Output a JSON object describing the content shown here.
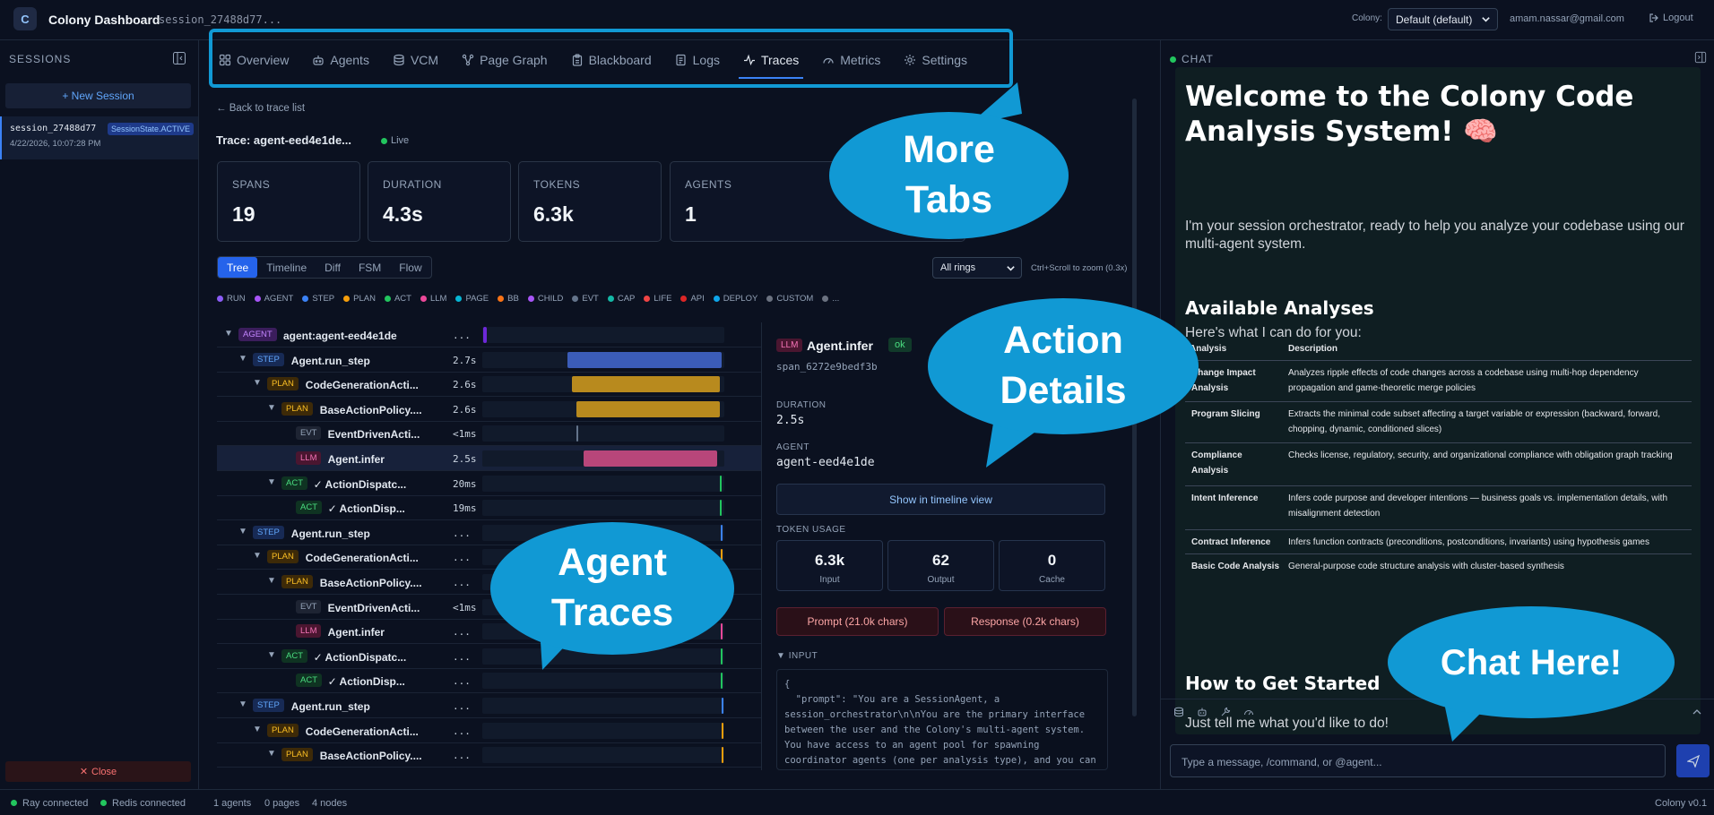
{
  "app": {
    "logo_letter": "C",
    "title": "Colony Dashboard",
    "session_chip": "session_27488d77...",
    "colony_label": "Colony:",
    "colony_value": "Default (default)",
    "user_email": "amam.nassar@gmail.com",
    "logout": "Logout"
  },
  "sidebar": {
    "heading": "SESSIONS",
    "new_session": "+ New Session",
    "session": {
      "name": "session_27488d77",
      "state": "SessionState.ACTIVE",
      "time": "4/22/2026, 10:07:28 PM"
    },
    "close": "Close"
  },
  "tabs": [
    {
      "label": "Overview",
      "icon": "grid-icon"
    },
    {
      "label": "Agents",
      "icon": "robot-icon"
    },
    {
      "label": "VCM",
      "icon": "database-icon"
    },
    {
      "label": "Page Graph",
      "icon": "graph-icon"
    },
    {
      "label": "Blackboard",
      "icon": "clipboard-icon"
    },
    {
      "label": "Logs",
      "icon": "logs-icon"
    },
    {
      "label": "Traces",
      "icon": "pulse-icon",
      "active": true
    },
    {
      "label": "Metrics",
      "icon": "gauge-icon"
    },
    {
      "label": "Settings",
      "icon": "gear-icon"
    }
  ],
  "trace": {
    "back": "← Back to trace list",
    "title": "Trace: agent-eed4e1de...",
    "live": "Live",
    "cards": [
      {
        "label": "SPANS",
        "value": "19"
      },
      {
        "label": "DURATION",
        "value": "4.3s"
      },
      {
        "label": "TOKENS",
        "value": "6.3k"
      },
      {
        "label": "AGENTS",
        "value": "1"
      }
    ],
    "view_tabs": [
      "Tree",
      "Timeline",
      "Diff",
      "FSM",
      "Flow"
    ],
    "rings_select": "All rings",
    "zoom_hint": "Ctrl+Scroll to zoom (0.3x)",
    "legend": [
      {
        "label": "RUN",
        "color": "#8b5cf6"
      },
      {
        "label": "AGENT",
        "color": "#a855f7"
      },
      {
        "label": "STEP",
        "color": "#3b82f6"
      },
      {
        "label": "PLAN",
        "color": "#f59e0b"
      },
      {
        "label": "ACT",
        "color": "#22c55e"
      },
      {
        "label": "LLM",
        "color": "#ec4899"
      },
      {
        "label": "PAGE",
        "color": "#06b6d4"
      },
      {
        "label": "BB",
        "color": "#f97316"
      },
      {
        "label": "CHILD",
        "color": "#a855f7"
      },
      {
        "label": "EVT",
        "color": "#64748b"
      },
      {
        "label": "CAP",
        "color": "#14b8a6"
      },
      {
        "label": "LIFE",
        "color": "#ef4444"
      },
      {
        "label": "API",
        "color": "#dc2626"
      },
      {
        "label": "DEPLOY",
        "color": "#0ea5e9"
      },
      {
        "label": "CUSTOM",
        "color": "#6b7280"
      },
      {
        "label": "...",
        "color": "#6b7280"
      }
    ],
    "rows": [
      {
        "kind": "AGENT",
        "name": "agent:agent-eed4e1de",
        "dur": "...",
        "depth": 0,
        "caret": true
      },
      {
        "kind": "STEP",
        "name": "Agent.run_step",
        "dur": "2.7s",
        "depth": 1,
        "caret": true
      },
      {
        "kind": "PLAN",
        "name": "CodeGenerationActi...",
        "dur": "2.6s",
        "depth": 2,
        "caret": true
      },
      {
        "kind": "PLAN",
        "name": "BaseActionPolicy....",
        "dur": "2.6s",
        "depth": 3,
        "caret": true
      },
      {
        "kind": "EVT",
        "name": "EventDrivenActi...",
        "dur": "<1ms",
        "depth": 4,
        "caret": false
      },
      {
        "kind": "LLM",
        "name": "Agent.infer",
        "dur": "2.5s",
        "depth": 4,
        "caret": false,
        "selected": true
      },
      {
        "kind": "ACT",
        "name": "✓ ActionDispatc...",
        "dur": "20ms",
        "depth": 3,
        "caret": true
      },
      {
        "kind": "ACT",
        "name": "✓ ActionDisp...",
        "dur": "19ms",
        "depth": 4,
        "caret": false
      },
      {
        "kind": "STEP",
        "name": "Agent.run_step",
        "dur": "...",
        "depth": 1,
        "caret": true
      },
      {
        "kind": "PLAN",
        "name": "CodeGenerationActi...",
        "dur": "...",
        "depth": 2,
        "caret": true
      },
      {
        "kind": "PLAN",
        "name": "BaseActionPolicy....",
        "dur": "...",
        "depth": 3,
        "caret": true
      },
      {
        "kind": "EVT",
        "name": "EventDrivenActi...",
        "dur": "<1ms",
        "depth": 4,
        "caret": false
      },
      {
        "kind": "LLM",
        "name": "Agent.infer",
        "dur": "...",
        "depth": 4,
        "caret": false
      },
      {
        "kind": "ACT",
        "name": "✓ ActionDispatc...",
        "dur": "...",
        "depth": 3,
        "caret": true
      },
      {
        "kind": "ACT",
        "name": "✓ ActionDisp...",
        "dur": "...",
        "depth": 4,
        "caret": false
      },
      {
        "kind": "STEP",
        "name": "Agent.run_step",
        "dur": "...",
        "depth": 1,
        "caret": true
      },
      {
        "kind": "PLAN",
        "name": "CodeGenerationActi...",
        "dur": "...",
        "depth": 2,
        "caret": true
      },
      {
        "kind": "PLAN",
        "name": "BaseActionPolicy....",
        "dur": "...",
        "depth": 3,
        "caret": true
      }
    ],
    "detail": {
      "kind": "LLM",
      "name": "Agent.infer",
      "status": "ok",
      "span": "span_6272e9bedf3b",
      "duration_label": "DURATION",
      "duration": "2.5s",
      "agent_label": "AGENT",
      "agent": "agent-eed4e1de",
      "timeline_button": "Show in timeline view",
      "token_label": "TOKEN USAGE",
      "tokens": [
        {
          "value": "6.3k",
          "label": "Input"
        },
        {
          "value": "62",
          "label": "Output"
        },
        {
          "value": "0",
          "label": "Cache"
        }
      ],
      "prompt_button": "Prompt (21.0k chars)",
      "response_button": "Response (0.2k chars)",
      "input_label": "INPUT",
      "input_text": "{\n  \"prompt\": \"You are a SessionAgent, a session_orchestrator\\n\\nYou are the primary interface between the user and the Colony's multi-agent system. You have access to an agent pool for spawning coordinator agents (one per analysis type), and you can respond directly to user questions."
    }
  },
  "chat": {
    "heading": "CHAT",
    "welcome": "Welcome to the Colony Code Analysis System! 🧠",
    "intro": "I'm your session orchestrator, ready to help you analyze your codebase using our multi-agent system.",
    "available_heading": "Available Analyses",
    "can_do": "Here's what I can do for you:",
    "table_headers": [
      "Analysis",
      "Description"
    ],
    "analyses": [
      {
        "name": "Change Impact Analysis",
        "desc": "Analyzes ripple effects of code changes across a codebase using multi-hop dependency propagation and game-theoretic merge policies"
      },
      {
        "name": "Program Slicing",
        "desc": "Extracts the minimal code subset affecting a target variable or expression (backward, forward, chopping, dynamic, conditioned slices)"
      },
      {
        "name": "Compliance Analysis",
        "desc": "Checks license, regulatory, security, and organizational compliance with obligation graph tracking"
      },
      {
        "name": "Intent Inference",
        "desc": "Infers code purpose and developer intentions — business goals vs. implementation details, with misalignment detection"
      },
      {
        "name": "Contract Inference",
        "desc": "Infers function contracts (preconditions, postconditions, invariants) using hypothesis games"
      },
      {
        "name": "Basic Code Analysis",
        "desc": "General-purpose code structure analysis with cluster-based synthesis"
      }
    ],
    "started_heading": "How to Get Started",
    "cta": "Just tell me what you'd like to do!",
    "input_placeholder": "Type a message, /command, or @agent..."
  },
  "footer": {
    "ray": "Ray connected",
    "redis": "Redis connected",
    "agents": "1 agents",
    "pages": "0 pages",
    "nodes": "4 nodes",
    "version": "Colony v0.1"
  },
  "callouts": {
    "tabs": "More Tabs",
    "details": "Action Details",
    "traces": "Agent Traces",
    "chat": "Chat Here!"
  },
  "colors": {
    "accent": "#3b82f6",
    "callout": "#1199d4",
    "background": "#0b1120"
  }
}
